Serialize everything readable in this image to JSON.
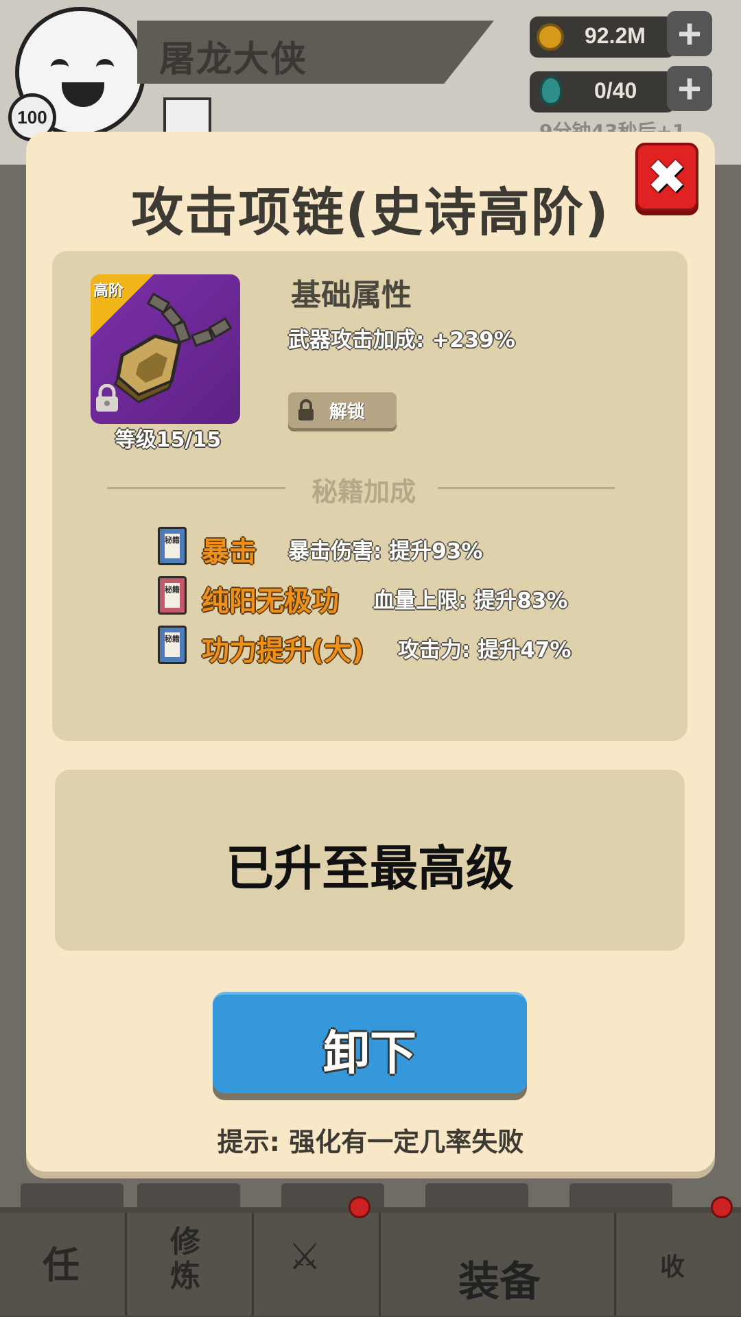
{
  "hud": {
    "player_name": "屠龙大侠",
    "player_level": "100",
    "gold": "92.2M",
    "energy": "0/40",
    "energy_timer": "9分钟43秒后+1",
    "plus_label": "+"
  },
  "nav": {
    "tasks_glyph": "任",
    "train_glyph": "修炼",
    "equip_label": "装备",
    "collect_glyph": "收"
  },
  "modal": {
    "title": "攻击项链(史诗高阶)",
    "close_glyph": "✖",
    "item": {
      "tier_label": "高阶",
      "level_label": "等级15/15"
    },
    "base_attr": {
      "heading": "基础属性",
      "stat": "武器攻击加成: +239%",
      "unlock_label": "解锁"
    },
    "secret_section": {
      "heading": "秘籍加成",
      "book_glyph": "秘籍",
      "skills": [
        {
          "name": "暴击",
          "effect": "暴击伤害: 提升93%",
          "book_color": "#4d7cb8"
        },
        {
          "name": "纯阳无极功",
          "effect": "血量上限: 提升83%",
          "book_color": "#c25a6a"
        },
        {
          "name": "功力提升(大)",
          "effect": "攻击力: 提升47%",
          "book_color": "#4d7cb8"
        }
      ]
    },
    "max_level_text": "已升至最高级",
    "unequip_label": "卸下",
    "hint": "提示: 强化有一定几率失败"
  },
  "colors": {
    "modal_bg": "#f8e8c8",
    "panel_bg": "#e0d1ad",
    "skill_name": "#f0901c",
    "button_blue": "#3498db",
    "close_red": "#e12222",
    "item_bg": "#7b2fa8",
    "tier_gold": "#f2b51a"
  }
}
